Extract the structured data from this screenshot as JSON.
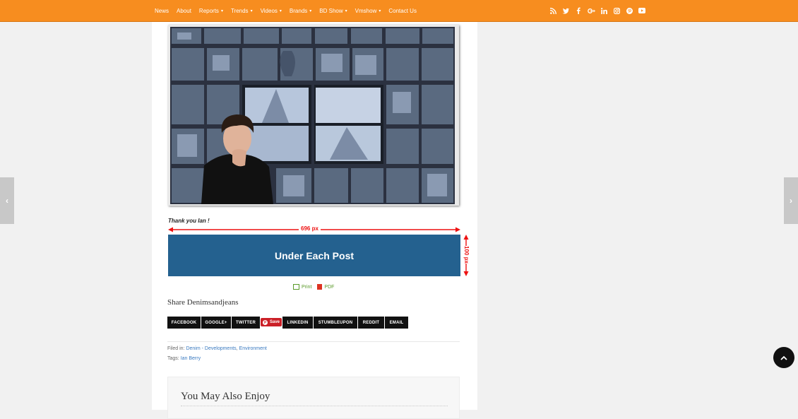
{
  "nav": {
    "items": [
      {
        "label": "News",
        "has_caret": false
      },
      {
        "label": "About",
        "has_caret": false
      },
      {
        "label": "Reports",
        "has_caret": true
      },
      {
        "label": "Trends",
        "has_caret": true
      },
      {
        "label": "Videos",
        "has_caret": true
      },
      {
        "label": "Brands",
        "has_caret": true
      },
      {
        "label": "BD Show",
        "has_caret": true
      },
      {
        "label": "Vmshow",
        "has_caret": true
      },
      {
        "label": "Contact Us",
        "has_caret": false
      }
    ],
    "caret_glyph": "▾",
    "social_icons": [
      "rss-icon",
      "twitter-icon",
      "facebook-icon",
      "google-plus-icon",
      "linkedin-icon",
      "instagram-icon",
      "pinterest-icon",
      "youtube-icon"
    ],
    "bar_color": "#f78d1f"
  },
  "post": {
    "caption": "Thank you Ian !",
    "ad": {
      "label": "Under Each Post",
      "width_label": "696 px",
      "height_label": "100 px",
      "color": "#24618f"
    },
    "print_label": "Print",
    "pdf_label": "PDF",
    "share_title": "Share Denimsandjeans",
    "share_buttons": [
      "FACEBOOK",
      "GOOGLE+",
      "TWITTER",
      "LINKEDIN",
      "STUMBLEUPON",
      "REDDIT",
      "EMAIL"
    ],
    "save_label": "Save",
    "filed_in_label": "Filed in:",
    "filed_in_links": [
      "Denim - Developments",
      "Environment"
    ],
    "tags_label": "Tags:",
    "tags": [
      "Ian Berry"
    ],
    "related_title": "You May Also Enjoy"
  }
}
